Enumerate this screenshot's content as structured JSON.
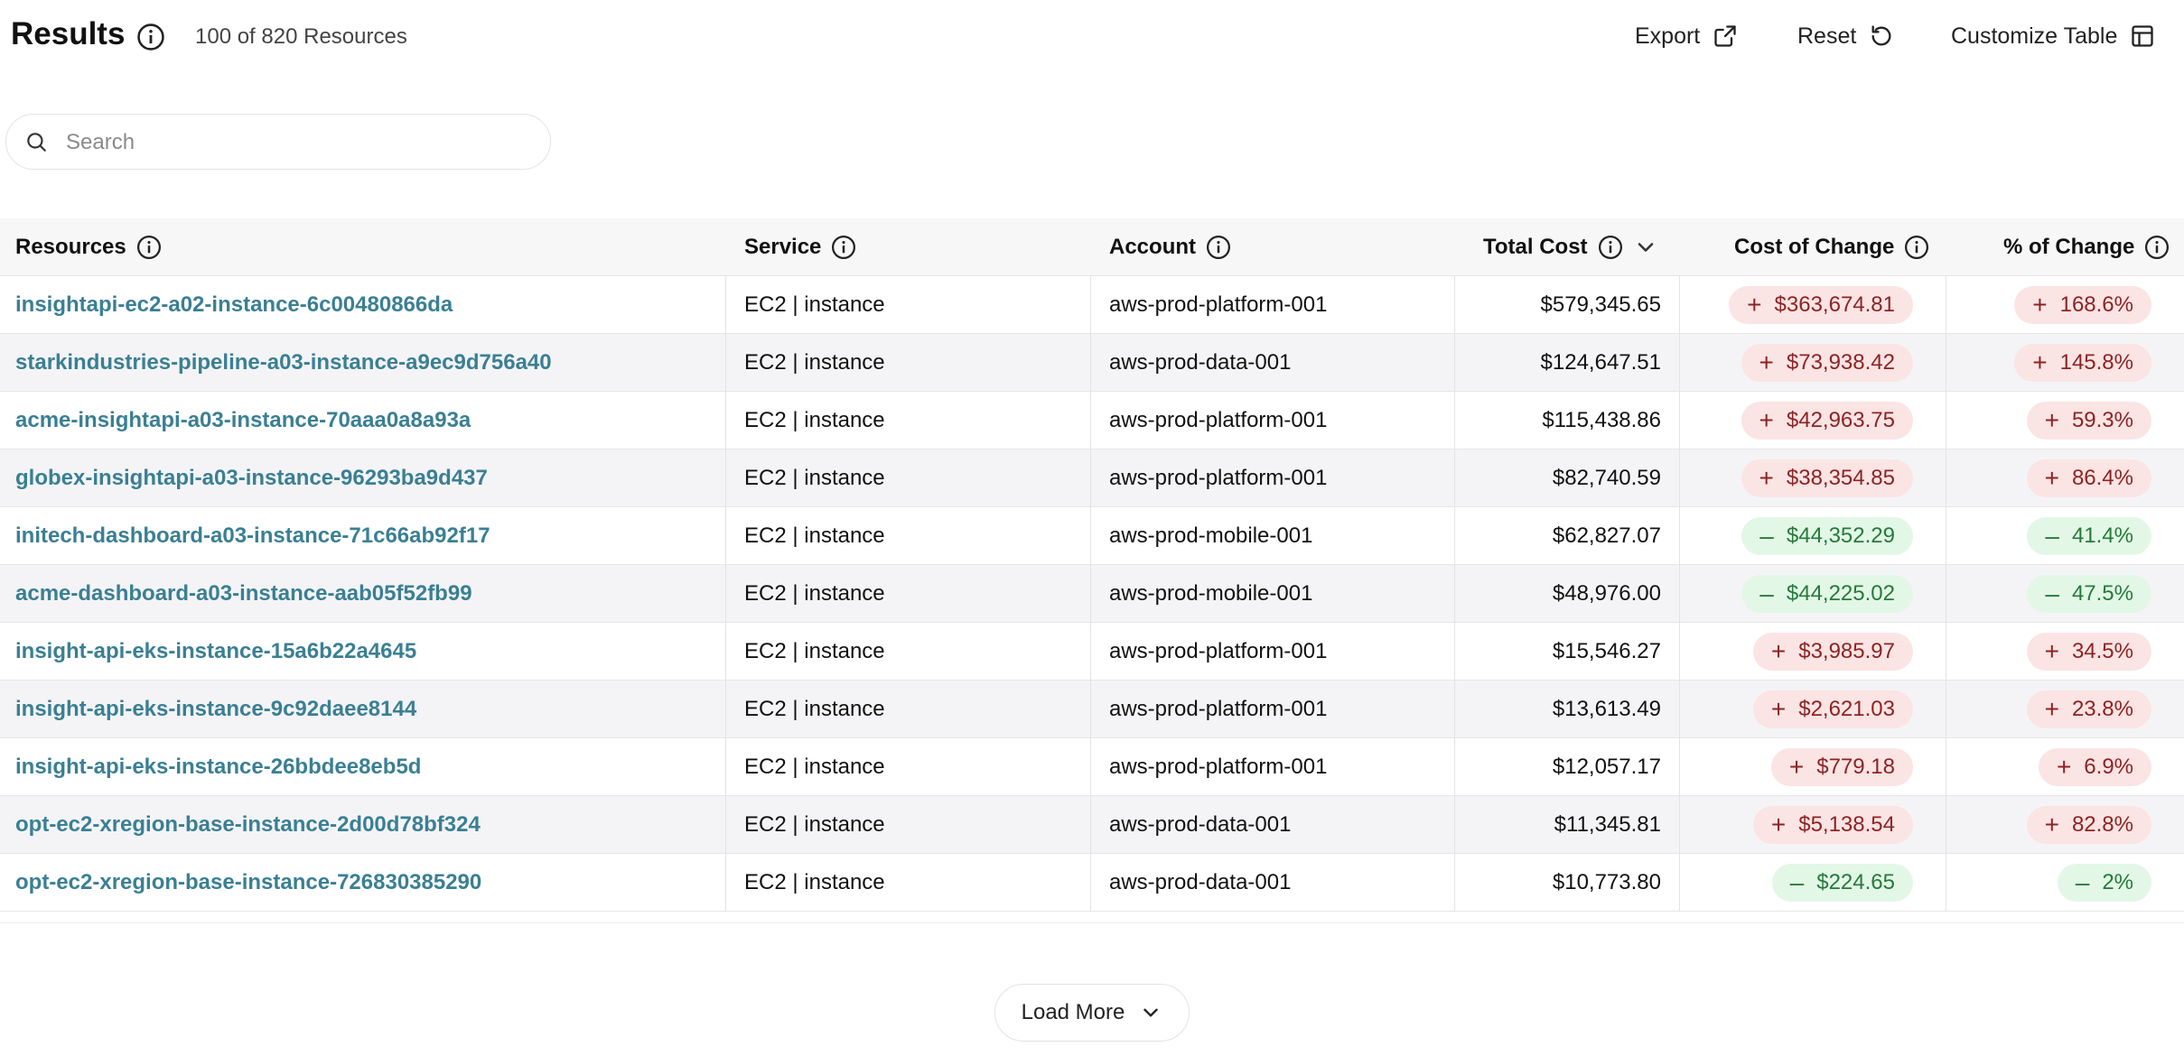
{
  "header": {
    "title": "Results",
    "count_text": "100 of 820 Resources",
    "export_label": "Export",
    "reset_label": "Reset",
    "customize_label": "Customize Table"
  },
  "search": {
    "placeholder": "Search",
    "value": ""
  },
  "table": {
    "columns": {
      "resources": "Resources",
      "service": "Service",
      "account": "Account",
      "total_cost": "Total Cost",
      "cost_of_change": "Cost of Change",
      "pct_of_change": "% of Change"
    },
    "sort": {
      "column": "total_cost",
      "direction": "desc"
    },
    "rows": [
      {
        "resource": "insightapi-ec2-a02-instance-6c00480866da",
        "service": "EC2 | instance",
        "account": "aws-prod-platform-001",
        "total_cost": "$579,345.65",
        "change_sign": "+",
        "cost_of_change": "$363,674.81",
        "pct_sign": "+",
        "pct_of_change": "168.6%",
        "trend": "up"
      },
      {
        "resource": "starkindustries-pipeline-a03-instance-a9ec9d756a40",
        "service": "EC2 | instance",
        "account": "aws-prod-data-001",
        "total_cost": "$124,647.51",
        "change_sign": "+",
        "cost_of_change": "$73,938.42",
        "pct_sign": "+",
        "pct_of_change": "145.8%",
        "trend": "up"
      },
      {
        "resource": "acme-insightapi-a03-instance-70aaa0a8a93a",
        "service": "EC2 | instance",
        "account": "aws-prod-platform-001",
        "total_cost": "$115,438.86",
        "change_sign": "+",
        "cost_of_change": "$42,963.75",
        "pct_sign": "+",
        "pct_of_change": "59.3%",
        "trend": "up"
      },
      {
        "resource": "globex-insightapi-a03-instance-96293ba9d437",
        "service": "EC2 | instance",
        "account": "aws-prod-platform-001",
        "total_cost": "$82,740.59",
        "change_sign": "+",
        "cost_of_change": "$38,354.85",
        "pct_sign": "+",
        "pct_of_change": "86.4%",
        "trend": "up"
      },
      {
        "resource": "initech-dashboard-a03-instance-71c66ab92f17",
        "service": "EC2 | instance",
        "account": "aws-prod-mobile-001",
        "total_cost": "$62,827.07",
        "change_sign": "–",
        "cost_of_change": "$44,352.29",
        "pct_sign": "–",
        "pct_of_change": "41.4%",
        "trend": "down"
      },
      {
        "resource": "acme-dashboard-a03-instance-aab05f52fb99",
        "service": "EC2 | instance",
        "account": "aws-prod-mobile-001",
        "total_cost": "$48,976.00",
        "change_sign": "–",
        "cost_of_change": "$44,225.02",
        "pct_sign": "–",
        "pct_of_change": "47.5%",
        "trend": "down"
      },
      {
        "resource": "insight-api-eks-instance-15a6b22a4645",
        "service": "EC2 | instance",
        "account": "aws-prod-platform-001",
        "total_cost": "$15,546.27",
        "change_sign": "+",
        "cost_of_change": "$3,985.97",
        "pct_sign": "+",
        "pct_of_change": "34.5%",
        "trend": "up"
      },
      {
        "resource": "insight-api-eks-instance-9c92daee8144",
        "service": "EC2 | instance",
        "account": "aws-prod-platform-001",
        "total_cost": "$13,613.49",
        "change_sign": "+",
        "cost_of_change": "$2,621.03",
        "pct_sign": "+",
        "pct_of_change": "23.8%",
        "trend": "up"
      },
      {
        "resource": "insight-api-eks-instance-26bbdee8eb5d",
        "service": "EC2 | instance",
        "account": "aws-prod-platform-001",
        "total_cost": "$12,057.17",
        "change_sign": "+",
        "cost_of_change": "$779.18",
        "pct_sign": "+",
        "pct_of_change": "6.9%",
        "trend": "up"
      },
      {
        "resource": "opt-ec2-xregion-base-instance-2d00d78bf324",
        "service": "EC2 | instance",
        "account": "aws-prod-data-001",
        "total_cost": "$11,345.81",
        "change_sign": "+",
        "cost_of_change": "$5,138.54",
        "pct_sign": "+",
        "pct_of_change": "82.8%",
        "trend": "up"
      },
      {
        "resource": "opt-ec2-xregion-base-instance-726830385290",
        "service": "EC2 | instance",
        "account": "aws-prod-data-001",
        "total_cost": "$10,773.80",
        "change_sign": "–",
        "cost_of_change": "$224.65",
        "pct_sign": "–",
        "pct_of_change": "2%",
        "trend": "down"
      }
    ]
  },
  "load_more": {
    "label": "Load More"
  },
  "colors": {
    "link": "#3a7f94",
    "increase_bg": "#fbe4e4",
    "increase_text": "#8e2323",
    "decrease_bg": "#e3f7e6",
    "decrease_text": "#257a3a",
    "header_bg": "#f7f7f7",
    "alt_row_bg": "#f4f4f6"
  }
}
